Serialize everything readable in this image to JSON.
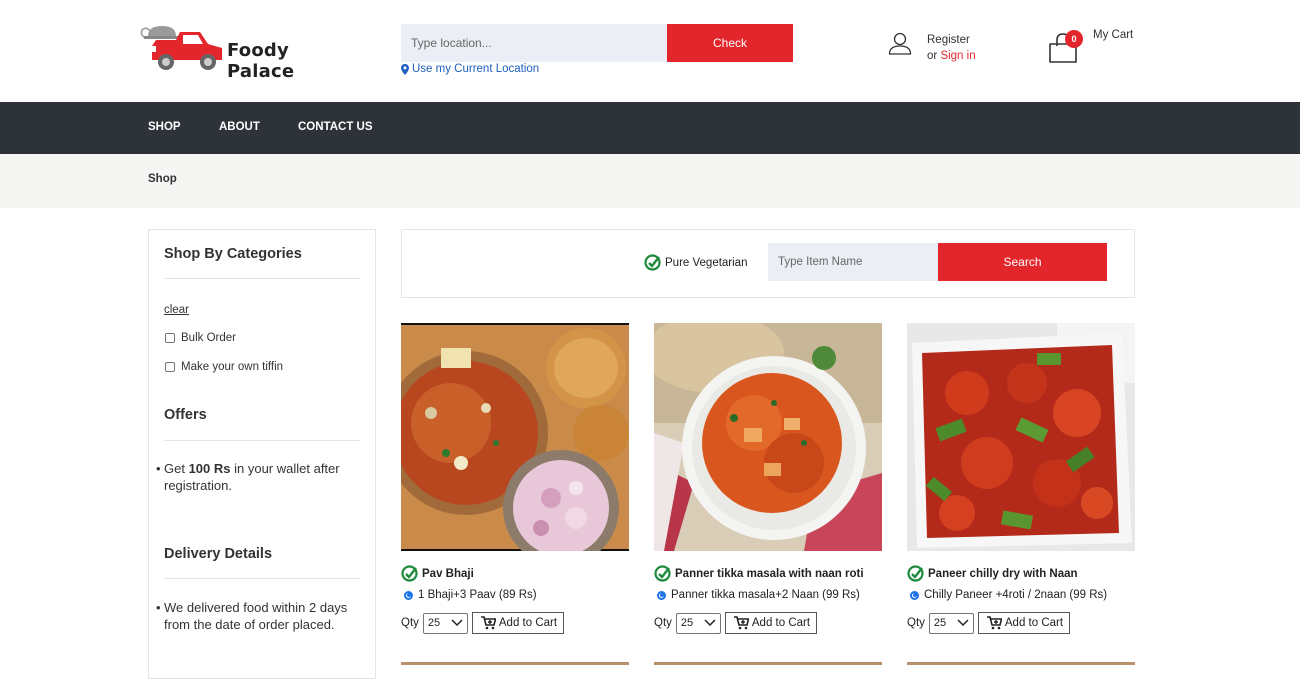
{
  "brand": {
    "name": "Foody Palace"
  },
  "location": {
    "placeholder": "Type location...",
    "check_label": "Check",
    "current_location_label": "Use my Current Location"
  },
  "account": {
    "register_label": "Register",
    "or_label": "or",
    "signin_label": "Sign in"
  },
  "cart": {
    "count": "0",
    "label": "My Cart"
  },
  "nav": {
    "items": [
      {
        "label": "SHOP"
      },
      {
        "label": "ABOUT"
      },
      {
        "label": "CONTACT US"
      }
    ]
  },
  "breadcrumb": {
    "current": "Shop"
  },
  "sidebar": {
    "categories_title": "Shop By Categories",
    "clear_label": "clear",
    "categories": [
      {
        "label": "Bulk Order"
      },
      {
        "label": "Make your own tiffin"
      }
    ],
    "offers_title": "Offers",
    "offer": {
      "prefix": "Get ",
      "amount": "100 Rs",
      "suffix": " in your wallet after registration."
    },
    "delivery_title": "Delivery Details",
    "delivery_text": "We delivered food within 2 days from the date of order placed."
  },
  "search": {
    "pure_veg_label": "Pure Vegetarian",
    "placeholder": "Type Item Name",
    "button_label": "Search"
  },
  "products": [
    {
      "name": "Pav Bhaji",
      "variant": "1 Bhaji+3 Paav (89 Rs)",
      "qty_label": "Qty",
      "qty": "25",
      "add_label": "Add to Cart"
    },
    {
      "name": "Panner tikka masala with naan roti",
      "variant": "Panner tikka masala+2 Naan (99 Rs)",
      "qty_label": "Qty",
      "qty": "25",
      "add_label": "Add to Cart"
    },
    {
      "name": "Paneer chilly dry with Naan",
      "variant": "Chilly Paneer +4roti / 2naan (99 Rs)",
      "qty_label": "Qty",
      "qty": "25",
      "add_label": "Add to Cart"
    }
  ],
  "colors": {
    "accent": "#e3262b",
    "nav_bg": "#2d3339",
    "veg_green": "#1e8a3c",
    "link_blue": "#1e5fbf"
  }
}
